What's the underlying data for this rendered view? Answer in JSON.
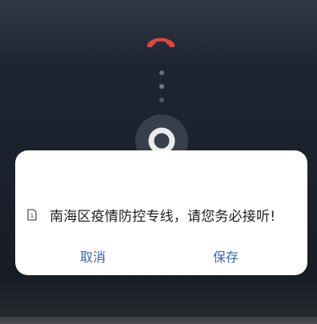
{
  "call_screen": {
    "hangup_icon": "hang-up-phone-icon",
    "slider_icon": "ring-slider-icon",
    "hangup_color": "#e0473f"
  },
  "dialog": {
    "icon": "sim-1-icon",
    "sim_label": "1",
    "message": "南海区疫情防控专线，请您务必接听!",
    "cancel_label": "取消",
    "save_label": "保存",
    "button_color": "#3a66b3"
  }
}
